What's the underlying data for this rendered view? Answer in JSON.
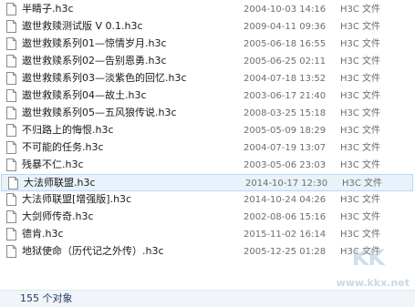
{
  "files": [
    {
      "name": "半睛子.h3c",
      "date": "2004-10-03 14:16",
      "type": "H3C 文件"
    },
    {
      "name": "遨世救赎测试版 V 0.1.h3c",
      "date": "2009-04-11 09:36",
      "type": "H3C 文件"
    },
    {
      "name": "遨世救赎系列01—惊情岁月.h3c",
      "date": "2005-06-18 16:55",
      "type": "H3C 文件"
    },
    {
      "name": "遨世救赎系列02—告别恩勇.h3c",
      "date": "2005-06-25 02:11",
      "type": "H3C 文件"
    },
    {
      "name": "遨世救赎系列03—淡紫色的回忆.h3c",
      "date": "2004-07-18 13:52",
      "type": "H3C 文件"
    },
    {
      "name": "遨世救赎系列04—故土.h3c",
      "date": "2003-06-17 21:40",
      "type": "H3C 文件"
    },
    {
      "name": "遨世救赎系列05—五风狼传说.h3c",
      "date": "2008-03-25 15:18",
      "type": "H3C 文件"
    },
    {
      "name": "不归路上的悔恨.h3c",
      "date": "2005-05-09 18:29",
      "type": "H3C 文件"
    },
    {
      "name": "不可能的任务.h3c",
      "date": "2004-07-19 13:07",
      "type": "H3C 文件"
    },
    {
      "name": "残暴不仁.h3c",
      "date": "2003-05-06 23:03",
      "type": "H3C 文件"
    },
    {
      "name": "大法师联盟.h3c",
      "date": "2014-10-17 12:30",
      "type": "H3C 文件",
      "selected": true
    },
    {
      "name": "大法师联盟[增强版].h3c",
      "date": "2014-10-24 04:26",
      "type": "H3C 文件"
    },
    {
      "name": "大剑师传奇.h3c",
      "date": "2002-08-06 15:16",
      "type": "H3C 文件"
    },
    {
      "name": "德肯.h3c",
      "date": "2015-11-02 16:14",
      "type": "H3C 文件"
    },
    {
      "name": "地狱使命（历代记之外传）.h3c",
      "date": "2005-12-25 01:28",
      "type": "H3C 文件"
    }
  ],
  "status": {
    "item_count": "155 个对象"
  },
  "watermark": {
    "logo": "KK",
    "url": "www.kkx.net"
  },
  "colors": {
    "selected_bg": "#e9f2fb",
    "selected_border": "#b8d6f4",
    "status_bar_bg": "#f1f5fa"
  }
}
